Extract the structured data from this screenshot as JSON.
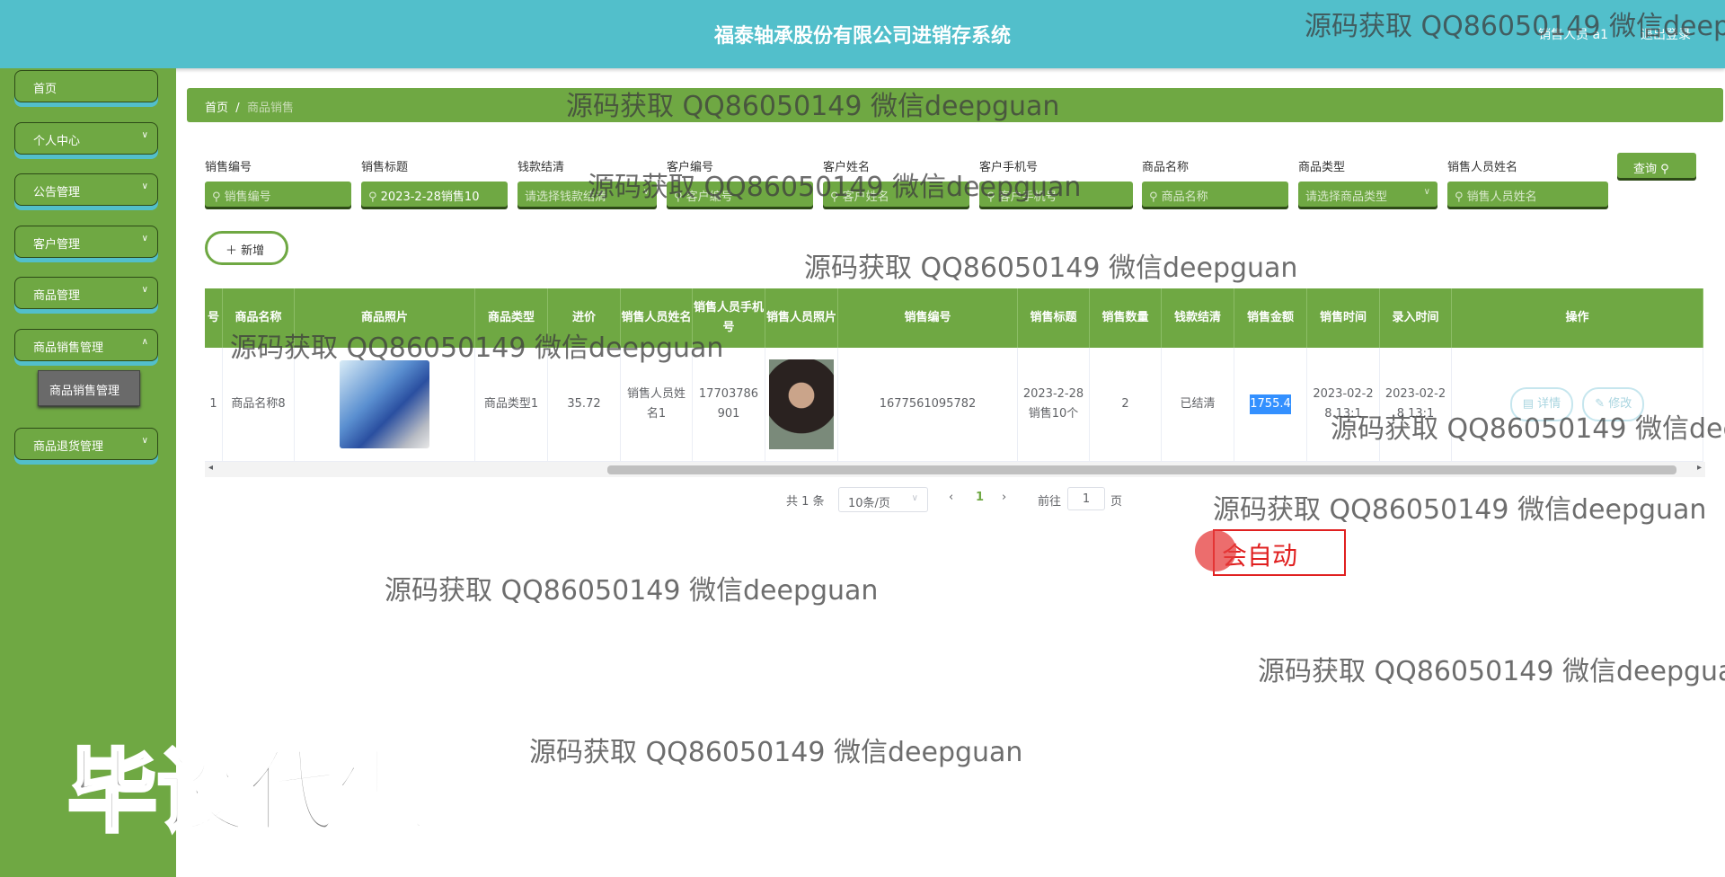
{
  "header": {
    "title": "福泰轴承股份有限公司进销存系统",
    "user": "销售人员 a1",
    "logout": "退出登录"
  },
  "sidebar": {
    "items": [
      {
        "label": "首页"
      },
      {
        "label": "个人中心"
      },
      {
        "label": "公告管理"
      },
      {
        "label": "客户管理"
      },
      {
        "label": "商品管理"
      },
      {
        "label": "商品销售管理"
      },
      {
        "label": "商品退货管理"
      }
    ],
    "sub_item": "商品销售管理"
  },
  "breadcrumb": {
    "home": "首页",
    "current": "商品销售"
  },
  "filters": [
    {
      "label": "销售编号",
      "placeholder": "销售编号",
      "value": ""
    },
    {
      "label": "销售标题",
      "placeholder": "",
      "value": "2023-2-28销售10"
    },
    {
      "label": "钱款结清",
      "placeholder": "请选择钱款结清",
      "value": ""
    },
    {
      "label": "客户编号",
      "placeholder": "客户编号",
      "value": ""
    },
    {
      "label": "客户姓名",
      "placeholder": "客户姓名",
      "value": ""
    },
    {
      "label": "客户手机号",
      "placeholder": "客户手机号",
      "value": ""
    },
    {
      "label": "商品名称",
      "placeholder": "商品名称",
      "value": ""
    },
    {
      "label": "商品类型",
      "placeholder": "请选择商品类型",
      "value": ""
    },
    {
      "label": "销售人员姓名",
      "placeholder": "销售人员姓名",
      "value": ""
    }
  ],
  "query_label": "查询",
  "add_label": "新增",
  "table": {
    "columns": [
      "号",
      "商品名称",
      "商品照片",
      "商品类型",
      "进价",
      "销售人员姓名",
      "销售人员手机号",
      "销售人员照片",
      "销售编号",
      "销售标题",
      "销售数量",
      "钱款结清",
      "销售金额",
      "销售时间",
      "录入时间",
      "操作"
    ],
    "rows": [
      {
        "index": "1",
        "name": "商品名称8",
        "type": "商品类型1",
        "price": "35.72",
        "seller": "销售人员姓名1",
        "phone": "17703786901",
        "code": "1677561095782",
        "title": "2023-2-28销售10个",
        "qty": "2",
        "settled": "已结清",
        "amount": "1755.4",
        "sale_time": "2023-02-28 13:1",
        "entry_time": "2023-02-28 13:1",
        "detail": "详情",
        "edit": "修改"
      }
    ]
  },
  "pagination": {
    "total": "共 1 条",
    "page_size": "10条/页",
    "current": "1",
    "goto": "前往",
    "goto_value": "1",
    "page_unit": "页"
  },
  "overlay": {
    "watermark": "源码获取 QQ86050149 微信deepguan",
    "big_text": "毕设代做",
    "typed": "会自动"
  },
  "colors": {
    "header": "#52bfcb",
    "sidebar": "#6fa843",
    "accent": "#6fa843"
  }
}
